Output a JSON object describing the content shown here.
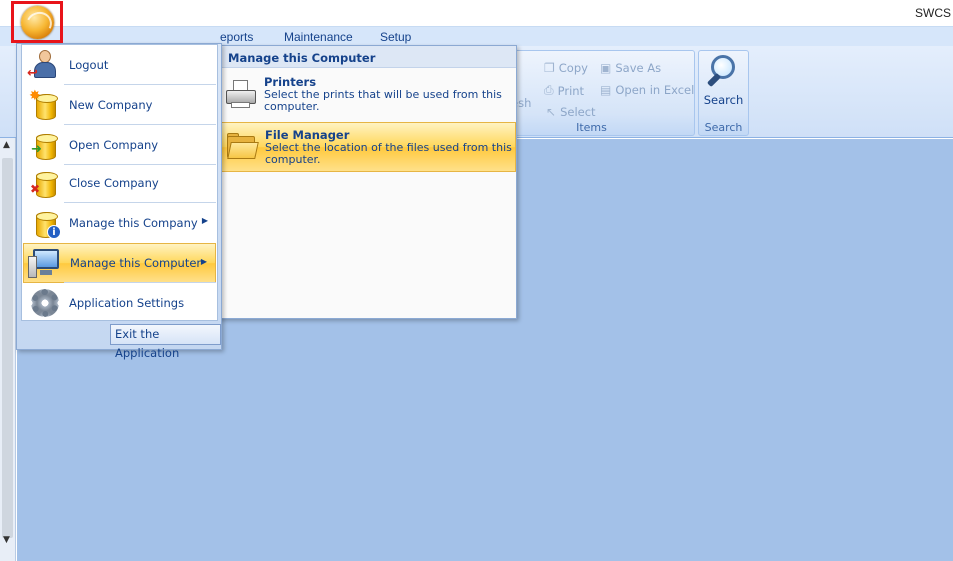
{
  "window": {
    "title": "SWCS"
  },
  "tabs": [
    {
      "label": "eports"
    },
    {
      "label": "Maintenance"
    },
    {
      "label": "Setup"
    }
  ],
  "ribbon": {
    "items_group": {
      "label": "Items",
      "partial_label": "esh",
      "buttons": [
        {
          "label": "Copy",
          "icon": "copy-icon"
        },
        {
          "label": "Save As",
          "icon": "save-as-icon"
        },
        {
          "label": "Print",
          "icon": "print-icon"
        },
        {
          "label": "Open in Excel",
          "icon": "excel-icon"
        },
        {
          "label": "Select",
          "icon": "select-cursor-icon"
        }
      ]
    },
    "search_group": {
      "label": "Search",
      "button_label": "Search",
      "icon": "magnifier-icon"
    }
  },
  "app_menu": {
    "items": [
      {
        "label": "Logout",
        "icon": "logout-user-icon"
      },
      {
        "label": "New Company",
        "icon": "new-database-icon"
      },
      {
        "label": "Open Company",
        "icon": "open-database-icon"
      },
      {
        "label": "Close Company",
        "icon": "close-database-icon"
      },
      {
        "label": "Manage this Company",
        "icon": "database-info-icon",
        "has_submenu": true
      },
      {
        "label": "Manage this Computer",
        "icon": "computer-icon",
        "has_submenu": true,
        "selected": true
      },
      {
        "label": "Application Settings",
        "icon": "gear-icon"
      }
    ],
    "exit_label": "Exit the Application"
  },
  "submenu": {
    "title": "Manage this Computer",
    "items": [
      {
        "title": "Printers",
        "description": "Select the prints that will be used from this computer.",
        "icon": "printer-icon"
      },
      {
        "title": "File Manager",
        "description": "Select the location of the files used from this computer.",
        "icon": "folder-icon",
        "selected": true
      }
    ]
  },
  "colors": {
    "accent_text": "#15428b",
    "work_area": "#a3c1e8",
    "highlight": "#ffd75a",
    "orb_outline": "#e8141a"
  }
}
